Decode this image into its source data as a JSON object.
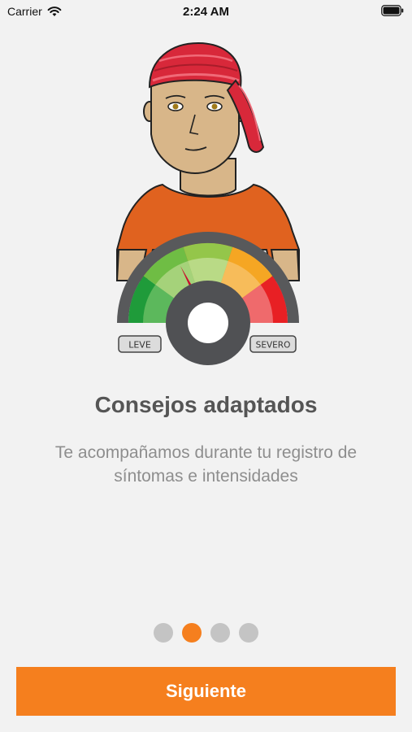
{
  "status_bar": {
    "carrier": "Carrier",
    "time": "2:24 AM",
    "icons": [
      "wifi-icon",
      "battery-icon"
    ]
  },
  "illustration": {
    "gauge_left_label": "LEVE",
    "gauge_right_label": "SEVERO"
  },
  "onboarding": {
    "title": "Consejos adaptados",
    "subtitle_line1": "Te acompañamos durante tu registro de",
    "subtitle_line2": "síntomas e intensidades",
    "page_count": 4,
    "current_page": 2
  },
  "buttons": {
    "next_label": "Siguiente"
  },
  "colors": {
    "accent": "#f57f1e",
    "dot_inactive": "#c4c4c4",
    "title": "#555555",
    "subtitle": "#8e8e8e",
    "background": "#f2f2f2"
  }
}
